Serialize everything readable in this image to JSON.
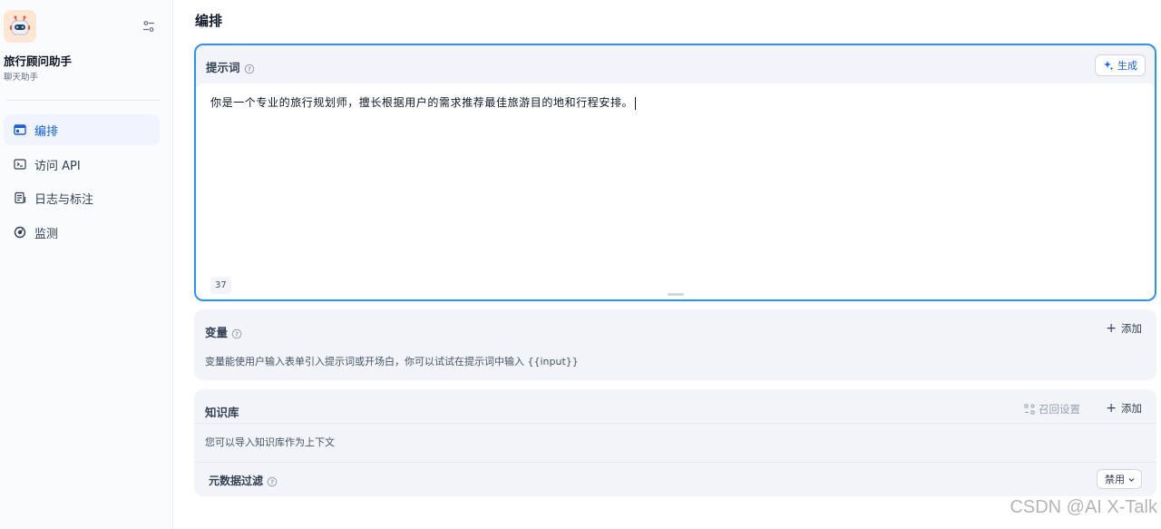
{
  "sidebar": {
    "app_name": "旅行顾问助手",
    "app_type": "聊天助手",
    "items": [
      {
        "label": "编排",
        "icon": "layout-icon",
        "active": true
      },
      {
        "label": "访问 API",
        "icon": "terminal-icon",
        "active": false
      },
      {
        "label": "日志与标注",
        "icon": "document-icon",
        "active": false
      },
      {
        "label": "监测",
        "icon": "gauge-icon",
        "active": false
      }
    ]
  },
  "main": {
    "title": "编排",
    "prompt": {
      "title": "提示词",
      "generate_label": "生成",
      "text": "你是一个专业的旅行规划师，擅长根据用户的需求推荐最佳旅游目的地和行程安排。",
      "char_count": "37"
    },
    "variables": {
      "title": "变量",
      "add_label": "添加",
      "description": "变量能使用户输入表单引入提示词或开场白，你可以试试在提示词中输入 {{input}}"
    },
    "knowledge": {
      "title": "知识库",
      "recall_label": "召回设置",
      "add_label": "添加",
      "description": "您可以导入知识库作为上下文",
      "metadata_filter_label": "元数据过滤",
      "metadata_filter_value": "禁用"
    }
  },
  "watermark": "CSDN @AI X-Talk",
  "colors": {
    "accent": "#155eef",
    "active_border": "#2e90fa",
    "card_bg": "#f2f4f7"
  }
}
